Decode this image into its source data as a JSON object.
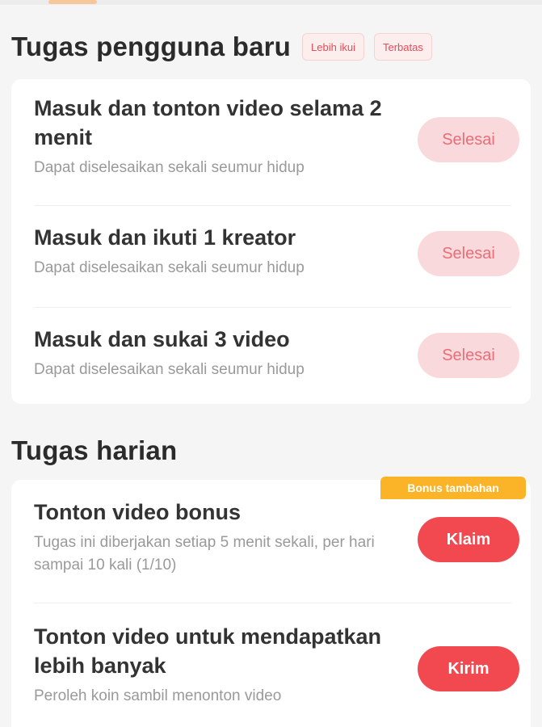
{
  "new_user_tasks": {
    "title": "Tugas pengguna baru",
    "tags": [
      "Lebih ikui",
      "Terbatas"
    ],
    "items": [
      {
        "title": "Masuk dan tonton video selama 2 menit",
        "description": "Dapat diselesaikan sekali seumur hidup",
        "button": "Selesai"
      },
      {
        "title": "Masuk dan ikuti 1 kreator",
        "description": "Dapat diselesaikan sekali seumur hidup",
        "button": "Selesai"
      },
      {
        "title": "Masuk dan sukai 3 video",
        "description": "Dapat diselesaikan sekali seumur hidup",
        "button": "Selesai"
      }
    ]
  },
  "daily_tasks": {
    "title": "Tugas harian",
    "items": [
      {
        "title": "Tonton video bonus",
        "description": "Tugas ini diberjakan setiap 5 menit sekali, per hari sampai 10 kali (1/10)",
        "button": "Klaim",
        "badge": "Bonus tambahan"
      },
      {
        "title": "Tonton video untuk mendapatkan lebih banyak",
        "description": "Peroleh koin sambil menonton video",
        "button": "Kirim"
      }
    ]
  },
  "colors": {
    "accent_red": "#f24950",
    "soft_red": "#fad9dc",
    "badge_orange": "#fbb427"
  }
}
